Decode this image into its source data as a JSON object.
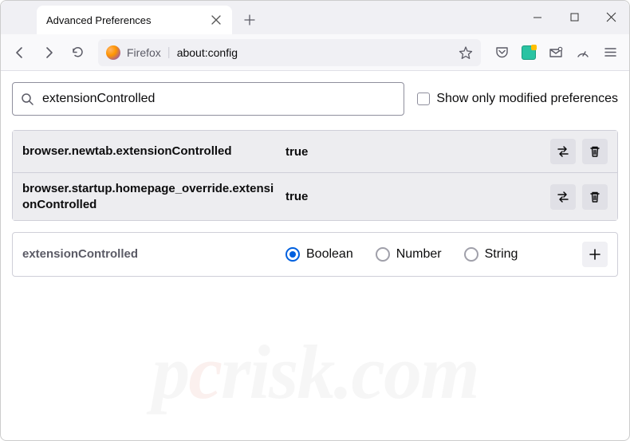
{
  "window": {
    "tab_title": "Advanced Preferences",
    "brand": "Firefox",
    "url": "about:config"
  },
  "search": {
    "value": "extensionControlled",
    "checkbox_label": "Show only modified preferences"
  },
  "prefs": [
    {
      "name": "browser.newtab.extensionControlled",
      "value": "true"
    },
    {
      "name": "browser.startup.homepage_override.extensionControlled",
      "value": "true"
    }
  ],
  "new_pref": {
    "name": "extensionControlled",
    "types": [
      "Boolean",
      "Number",
      "String"
    ],
    "selected": "Boolean"
  },
  "watermark": "pcrisk.com"
}
